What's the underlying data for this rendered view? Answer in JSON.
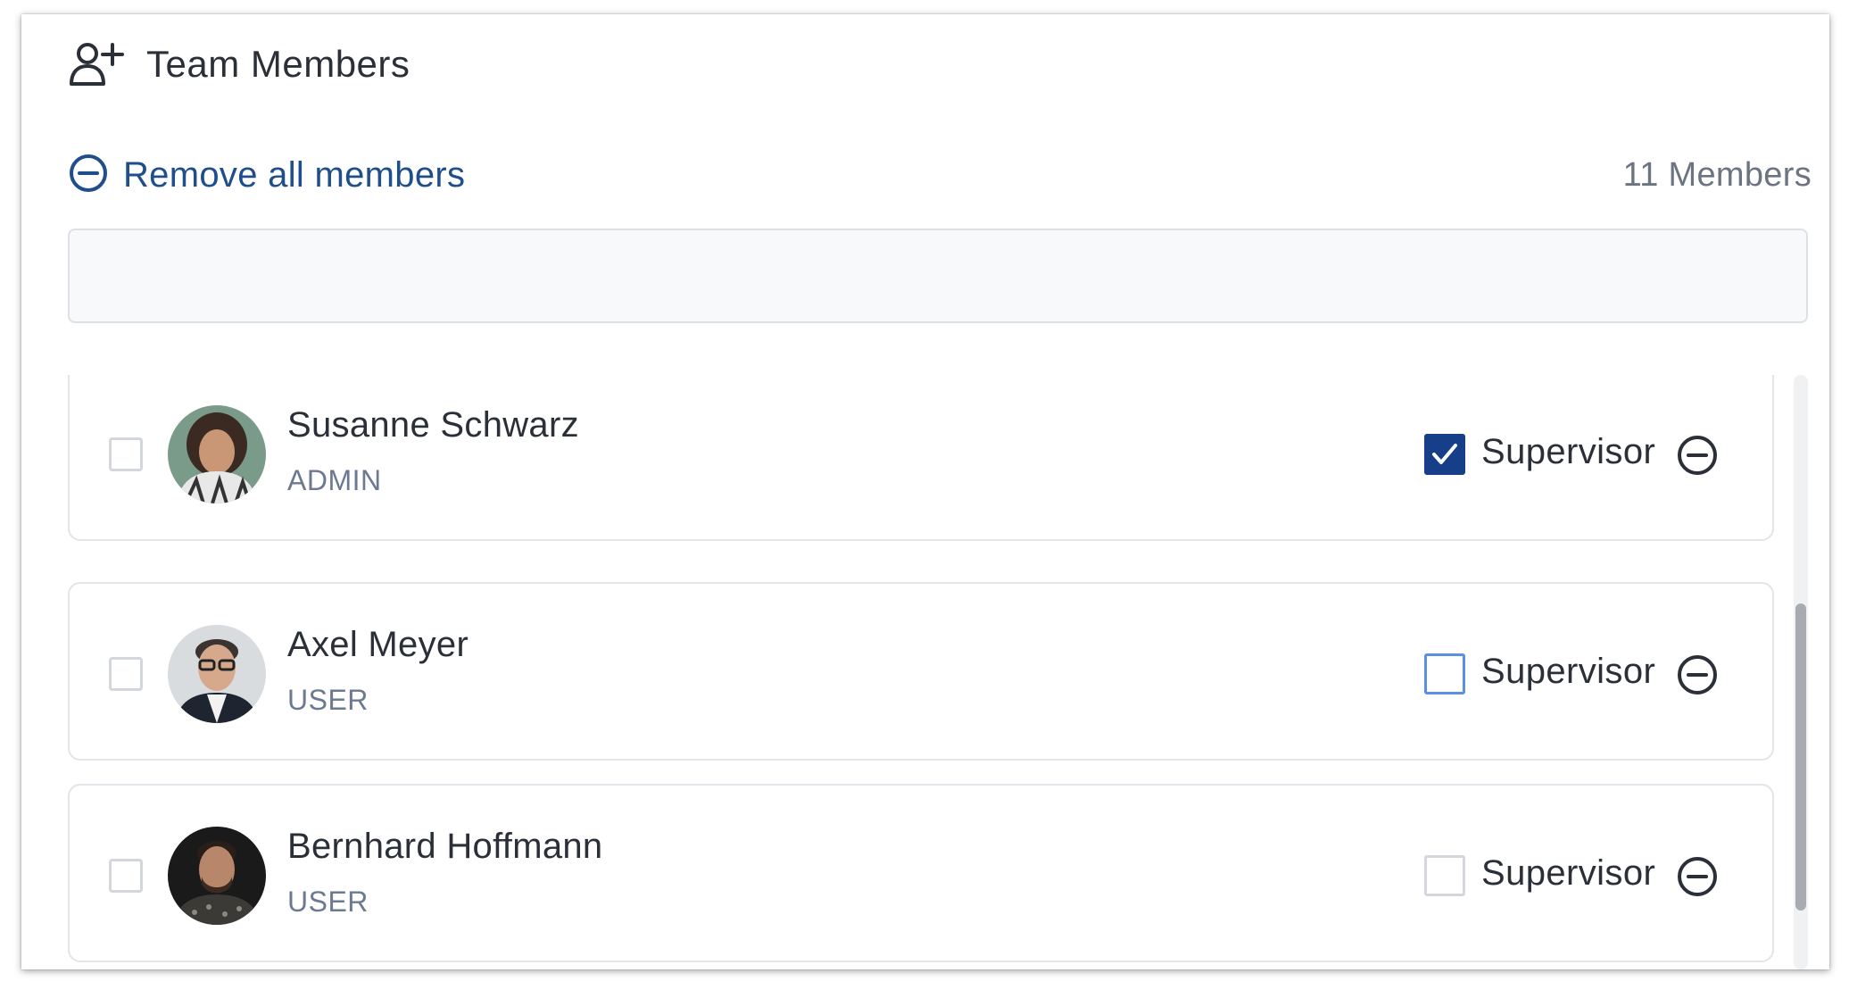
{
  "header": {
    "title": "Team Members",
    "icon": "user-plus-icon"
  },
  "actions": {
    "remove_all_label": "Remove all members",
    "member_count": "11 Members"
  },
  "search": {
    "value": "",
    "placeholder": ""
  },
  "members": [
    {
      "name": "Susanne Schwarz",
      "role": "ADMIN",
      "supervisor_label": "Supervisor",
      "supervisor": true
    },
    {
      "name": "Axel Meyer",
      "role": "USER",
      "supervisor_label": "Supervisor",
      "supervisor": false
    },
    {
      "name": "Bernhard Hoffmann",
      "role": "USER",
      "supervisor_label": "Supervisor",
      "supervisor": false
    }
  ],
  "colors": {
    "accent": "#173e88",
    "link": "#1f4e8c",
    "focus": "#5b8fe0",
    "text": "#2b3038",
    "muted": "#6b7a90"
  }
}
